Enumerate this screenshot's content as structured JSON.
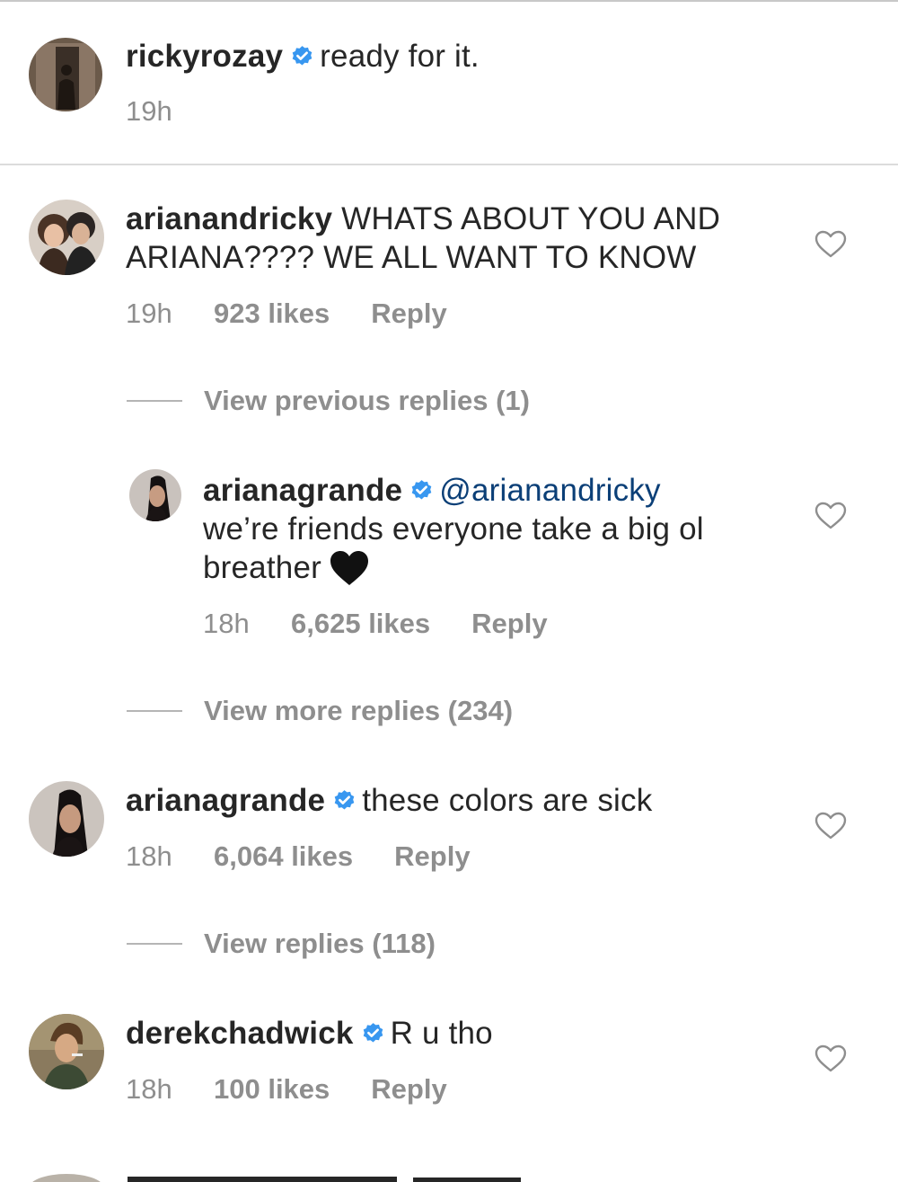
{
  "caption": {
    "username": "rickyrozay",
    "verified": true,
    "text": "ready for it.",
    "time": "19h"
  },
  "comments": [
    {
      "username": "arianandricky",
      "verified": false,
      "text_line1": "WHATS ABOUT YOU AND",
      "text_line2": "ARIANA???? WE ALL WANT TO KNOW",
      "time": "19h",
      "likes": "923 likes",
      "reply": "Reply",
      "view_link": "View previous replies (1)"
    },
    {
      "username": "arianagrande",
      "verified": true,
      "mention": "@arianandricky",
      "text_line1": "we’re friends everyone take a big ol",
      "text_line2": "breather",
      "emoji": "black-heart",
      "time": "18h",
      "likes": "6,625 likes",
      "reply": "Reply",
      "view_link": "View more replies (234)"
    },
    {
      "username": "arianagrande",
      "verified": true,
      "text": "these colors are sick",
      "time": "18h",
      "likes": "6,064 likes",
      "reply": "Reply",
      "view_link": "View replies (118)"
    },
    {
      "username": "derekchadwick",
      "verified": true,
      "text": "R u tho",
      "time": "18h",
      "likes": "100 likes",
      "reply": "Reply"
    }
  ],
  "icons": {
    "verified": "verified-badge-icon",
    "like": "heart-outline-icon"
  },
  "colors": {
    "verified_blue": "#3897f0",
    "meta_gray": "#8e8e8e",
    "text": "#262626"
  }
}
